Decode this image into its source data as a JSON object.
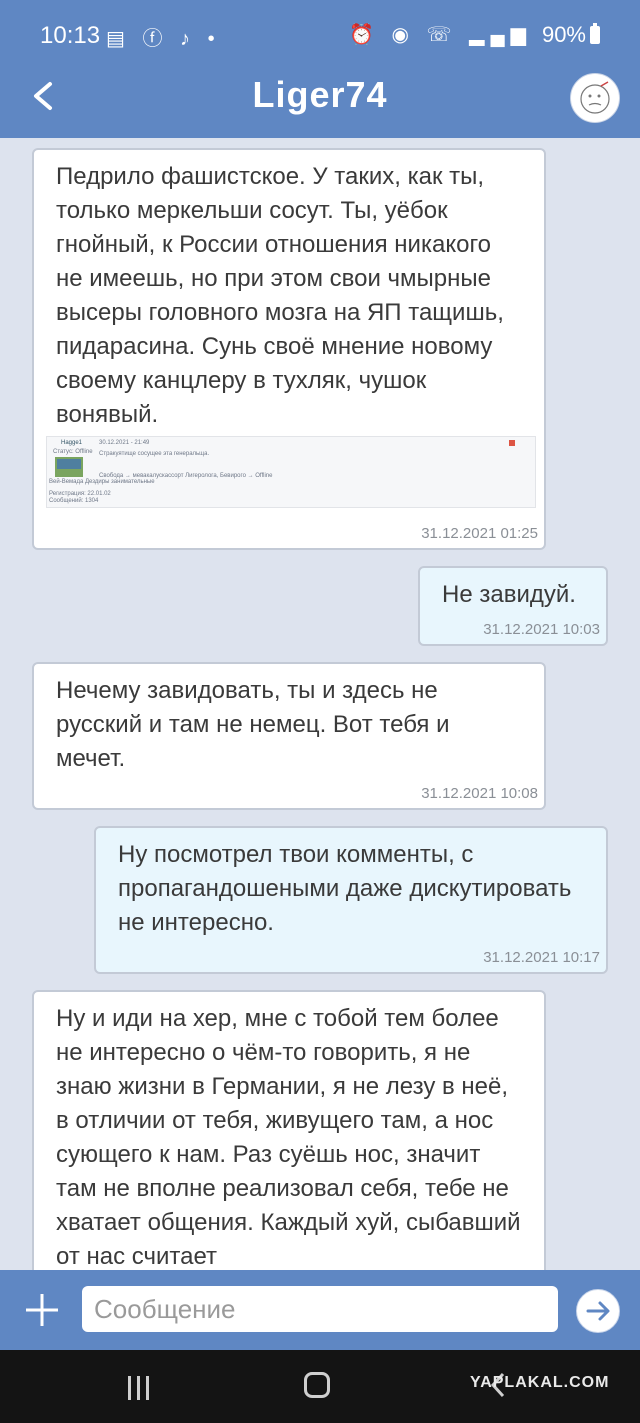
{
  "status_bar": {
    "time": "10:13",
    "left_icons": "▤ ⓕ ♪ •",
    "right_icons": "⏰ ◉ ☏ ▂▄▆",
    "battery": "90%"
  },
  "header": {
    "back_glyph": "<",
    "title": "Liger74"
  },
  "messages": [
    {
      "direction": "in",
      "text": "Педрило фашистское. У таких, как ты, только меркельши сосут. Ты, уёбок гнойный, к России отношения никакого не имеешь, но при этом свои чмырные высеры головного мозга на ЯП тащишь, пидарасина. Сунь своё мнение новому своему канцлеру в тухляк, чушок вонявый.",
      "time": "31.12.2021 01:25",
      "screenshot": {
        "user": "Hagge1",
        "date": "30.12.2021 - 21:49",
        "line1": "Стракуятище сосущее эта генеральща.",
        "line2": "Свобода → мевакалускассорт Лигеролога, Бевирого → Offline",
        "status": "Статус: Offline",
        "side1": "Вей-Вемада Дездиры занимательные",
        "side2": "Регистрация: 22.01.02",
        "side3": "Сообщений: 1304"
      }
    },
    {
      "direction": "out",
      "text": "Не завидуй.",
      "time": "31.12.2021 10:03"
    },
    {
      "direction": "in",
      "text": "Нечему завидовать, ты и здесь не русский и там не немец. Вот тебя и мечет.",
      "time": "31.12.2021 10:08"
    },
    {
      "direction": "out",
      "text": "Ну посмотрел твои комменты, с пропагандошеными даже дискутировать не интересно.",
      "time": "31.12.2021 10:17"
    },
    {
      "direction": "in",
      "text": "Ну и иди на хер, мне с тобой тем более не интересно о чём-то говорить, я не знаю жизни в Германии, я не лезу в неё, в отличии от тебя, живущего там, а нос сующего к нам. Раз суёшь нос, значит там не вполне реализовал себя, тебе не хватает общения. Каждый хуй, сыбавший от нас считает",
      "time": ""
    }
  ],
  "composer": {
    "placeholder": "Сообщение"
  },
  "watermark": "YAPLAKAL.COM",
  "colors": {
    "header_bg": "#5f87c3",
    "chat_bg": "#dde3ee",
    "incoming_bubble": "#ffffff",
    "outgoing_bubble": "#e8f6fd"
  }
}
